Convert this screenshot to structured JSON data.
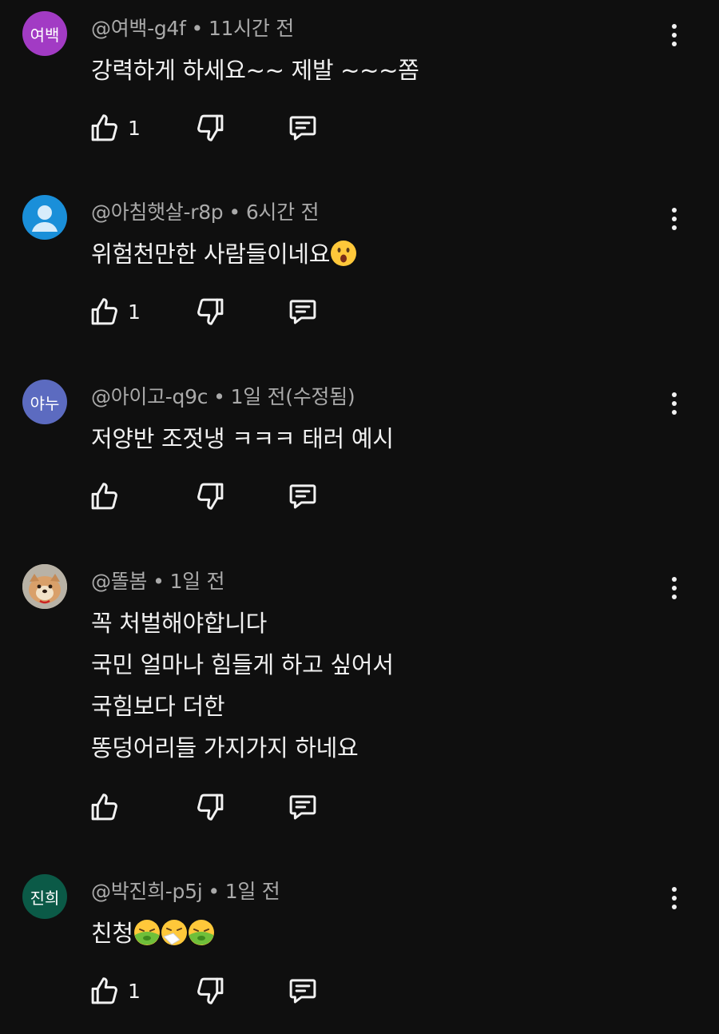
{
  "comments": [
    {
      "avatar": {
        "text": "여백",
        "color": "#a23bc4"
      },
      "handle": "@여백-g4f",
      "separator": "•",
      "time": "11시간 전",
      "lines": [
        "강력하게 하세요~~ 제발 ~~~쫌"
      ],
      "likes": "1"
    },
    {
      "avatar": {
        "text": "",
        "color": "#1a8fd9",
        "icon": "default-person-icon"
      },
      "handle": "@아침햇살-r8p",
      "separator": "•",
      "time": "6시간 전",
      "lines": [
        "위험천만한 사람들이네요"
      ],
      "emojis": [
        "astonished-face"
      ],
      "likes": "1"
    },
    {
      "avatar": {
        "text": "야누",
        "color": "#5c6bc0"
      },
      "handle": "@아이고-q9c",
      "separator": "•",
      "time": "1일 전(수정됨)",
      "lines": [
        "저양반 조젓냉 ㅋㅋㅋ 태러 예시"
      ],
      "likes": ""
    },
    {
      "avatar": {
        "text": "",
        "color": "#c8b8a0",
        "icon": "dog-photo"
      },
      "handle": "@똘봄",
      "separator": "•",
      "time": "1일 전",
      "lines": [
        "꼭 처벌해야합니다",
        "국민 얼마나 힘들게 하고 싶어서",
        "국힘보다 더한",
        "똥덩어리들 가지가지 하네요"
      ],
      "likes": ""
    },
    {
      "avatar": {
        "text": "진희",
        "color": "#0b5a47"
      },
      "handle": "@박진희-p5j",
      "separator": "•",
      "time": "1일 전",
      "lines": [
        "친청"
      ],
      "emojis": [
        "nauseated-face",
        "sneezing-face",
        "nauseated-face"
      ],
      "likes": "1"
    }
  ]
}
